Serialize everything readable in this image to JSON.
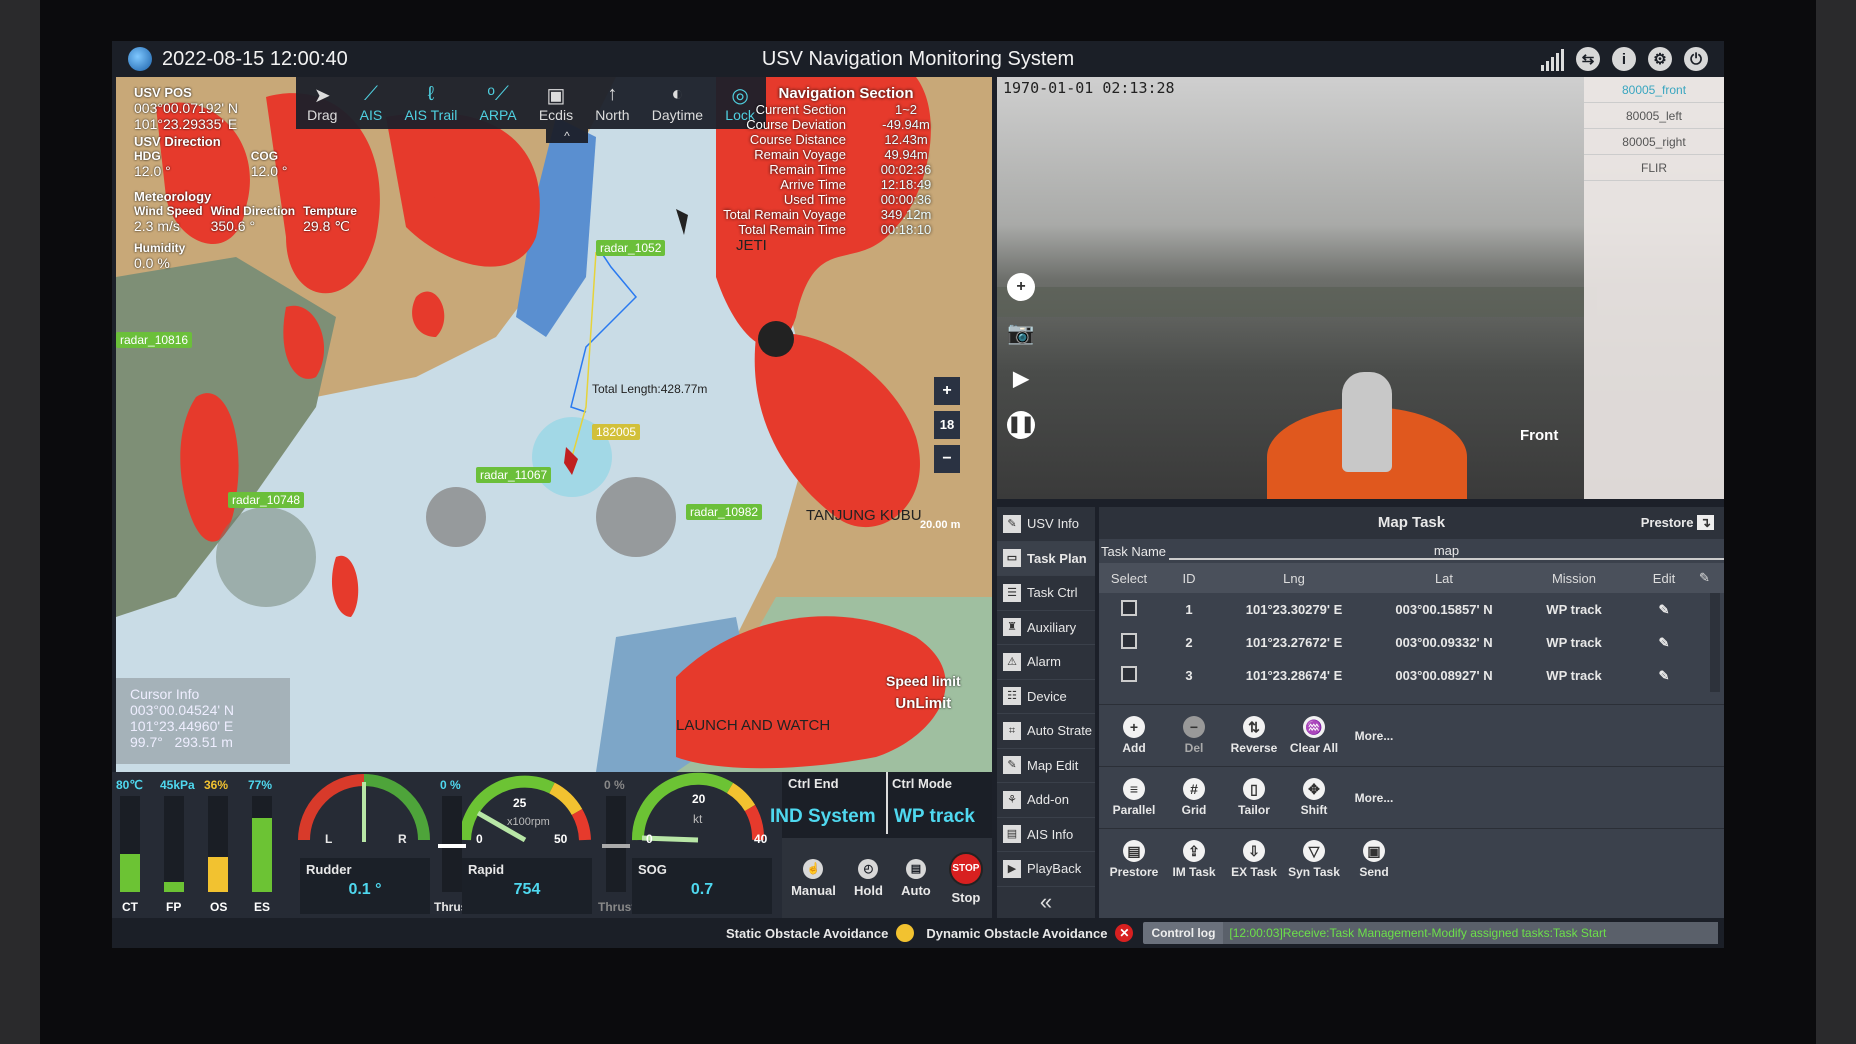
{
  "header": {
    "datetime": "2022-08-15 12:00:40",
    "title": "USV Navigation Monitoring System"
  },
  "toolbar": [
    {
      "label": "Drag",
      "icon": "navigation-arrow-icon",
      "active": false
    },
    {
      "label": "AIS",
      "icon": "ais-icon",
      "active": true
    },
    {
      "label": "AIS Trail",
      "icon": "ais-trail-icon",
      "active": true
    },
    {
      "label": "ARPA",
      "icon": "arpa-icon",
      "active": true
    },
    {
      "label": "Ecdis",
      "icon": "ecdis-icon",
      "active": false
    },
    {
      "label": "North",
      "icon": "north-arrow-icon",
      "active": false
    },
    {
      "label": "Daytime",
      "icon": "daytime-icon",
      "active": false
    },
    {
      "label": "Lock",
      "icon": "lock-target-icon",
      "active": true
    }
  ],
  "usv": {
    "pos_label": "USV POS",
    "lat": "003°00.07192' N",
    "lng": "101°23.29335' E",
    "dir_label": "USV Direction",
    "hdg_label": "HDG",
    "hdg": "12.0 °",
    "cog_label": "COG",
    "cog": "12.0 °",
    "met_label": "Meteorology",
    "wind_speed_label": "Wind Speed",
    "wind_speed": "2.3 m/s",
    "wind_dir_label": "Wind Direction",
    "wind_dir": "350.6 °",
    "temp_label": "Tempture",
    "temp": "29.8 ℃",
    "humidity_label": "Humidity",
    "humidity": "0.0 %"
  },
  "nav": {
    "title": "Navigation Section",
    "rows": [
      {
        "k": "Current Section",
        "v": "1~2"
      },
      {
        "k": "Course Deviation",
        "v": "-49.94m"
      },
      {
        "k": "Course Distance",
        "v": "12.43m"
      },
      {
        "k": "Remain Voyage",
        "v": "49.94m"
      },
      {
        "k": "Remain Time",
        "v": "00:02:36"
      },
      {
        "k": "Arrive Time",
        "v": "12:18:49"
      },
      {
        "k": "Used Time",
        "v": "00:00:36"
      },
      {
        "k": "Total Remain Voyage",
        "v": "349.12m"
      },
      {
        "k": "Total Remain Time",
        "v": "00:18:10"
      }
    ]
  },
  "map": {
    "labels": {
      "r1": "radar_10816",
      "r2": "radar_11067",
      "r3": "radar_10748",
      "r4": "radar_10982",
      "r5": "radar_1052",
      "ship": "182005"
    },
    "total_length": "Total Length:428.77m",
    "place1": "TANJUNG KUBU",
    "place2": "LAUNCH AND WATCH",
    "place3": "JETI",
    "zoom_level": "18",
    "zoom_in": "+",
    "zoom_out": "−",
    "scale": "20.00 m",
    "speed_limit_label": "Speed limit",
    "speed_limit": "UnLimit",
    "cursor": {
      "title": "Cursor Info",
      "lat": "003°00.04524' N",
      "lng": "101°23.44960' E",
      "bearing": "99.7°",
      "dist": "293.51 m"
    }
  },
  "gauges": {
    "bars": [
      {
        "label": "CT",
        "value": "80℃",
        "fill": 0.4,
        "color": "#6cc334",
        "vcolor": "#4fd8ef"
      },
      {
        "label": "FP",
        "value": "45kPa",
        "fill": 0.1,
        "color": "#6cc334",
        "vcolor": "#4fd8ef"
      },
      {
        "label": "OS",
        "value": "36%",
        "fill": 0.36,
        "color": "#f2c230",
        "vcolor": "#f2c230"
      },
      {
        "label": "ES",
        "value": "77%",
        "fill": 0.77,
        "color": "#6cc334",
        "vcolor": "#4fd8ef"
      }
    ],
    "rudder": {
      "label": "Rudder",
      "value": "0.1 °",
      "left": "L",
      "right": "R"
    },
    "thrust1": {
      "label": "Thrust",
      "value": "0 %"
    },
    "rapid": {
      "label": "Rapid",
      "value": "754",
      "unit": "x100rpm",
      "min": "0",
      "mid": "25",
      "max": "50"
    },
    "thrust2": {
      "label": "Thrust",
      "value": "0 %"
    },
    "sog": {
      "label": "SOG",
      "value": "0.7",
      "unit": "kt",
      "min": "0",
      "mid": "20",
      "max": "40"
    }
  },
  "ctrl": {
    "end_label": "Ctrl End",
    "end_value": "IND System",
    "mode_label": "Ctrl Mode",
    "mode_value": "WP track",
    "buttons": [
      "Manual",
      "Hold",
      "Auto",
      "Stop"
    ],
    "stop_text": "STOP"
  },
  "status": {
    "static_label": "Static Obstacle Avoidance",
    "dynamic_label": "Dynamic Obstacle Avoidance",
    "log_label": "Control log",
    "log_text": "[12:00:03]Receive:Task Management-Modify assigned tasks:Task Start"
  },
  "video": {
    "timestamp": "1970-01-01 02:13:28",
    "view": "Front",
    "cameras": [
      "80005_front",
      "80005_left",
      "80005_right",
      "FLIR"
    ],
    "active_camera": "80005_front"
  },
  "sidebar": [
    {
      "label": "USV Info"
    },
    {
      "label": "Task Plan",
      "active": true
    },
    {
      "label": "Task Ctrl"
    },
    {
      "label": "Auxiliary"
    },
    {
      "label": "Alarm"
    },
    {
      "label": "Device"
    },
    {
      "label": "Auto Strate"
    },
    {
      "label": "Map Edit"
    },
    {
      "label": "Add-on"
    },
    {
      "label": "AIS Info"
    },
    {
      "label": "PlayBack"
    }
  ],
  "task": {
    "title": "Map Task",
    "prestore": "Prestore",
    "name_label": "Task Name",
    "name_value": "map",
    "columns": [
      "Select",
      "ID",
      "Lng",
      "Lat",
      "Mission",
      "Edit"
    ],
    "rows": [
      {
        "id": "1",
        "lng": "101°23.30279' E",
        "lat": "003°00.15857' N",
        "mission": "WP track"
      },
      {
        "id": "2",
        "lng": "101°23.27672' E",
        "lat": "003°00.09332' N",
        "mission": "WP track"
      },
      {
        "id": "3",
        "lng": "101°23.28674' E",
        "lat": "003°00.08927' N",
        "mission": "WP track"
      }
    ],
    "actions1": [
      "Add",
      "Del",
      "Reverse",
      "Clear All",
      "More..."
    ],
    "actions2": [
      "Parallel",
      "Grid",
      "Tailor",
      "Shift",
      "More..."
    ],
    "actions3": [
      "Prestore",
      "IM Task",
      "EX Task",
      "Syn Task",
      "Send"
    ]
  }
}
